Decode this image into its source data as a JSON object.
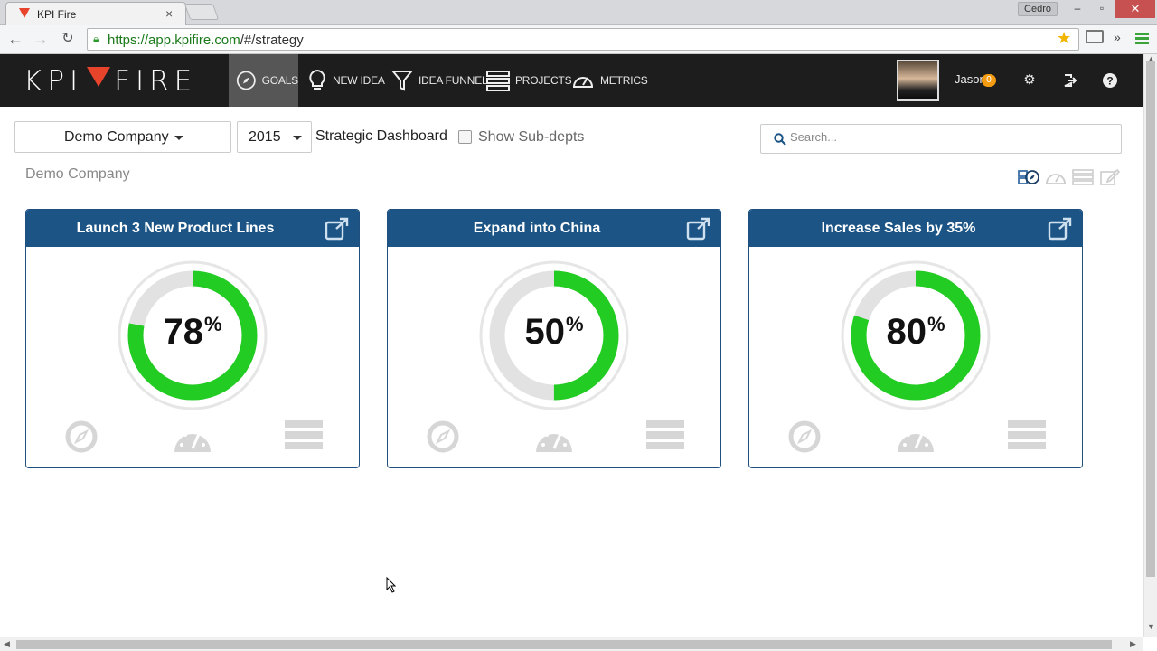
{
  "browser": {
    "tab_title": "KPI Fire",
    "tab_close": "×",
    "profile": "Cedro",
    "url_host": "https://app.kpifire.com",
    "url_path": "/#/strategy",
    "win_min": "–",
    "win_max": "▫",
    "win_close": "✕"
  },
  "app": {
    "logo": {
      "left": "KPI",
      "right": "FIRE"
    },
    "nav": [
      {
        "label": "GOALS",
        "icon": "compass-icon",
        "active": true
      },
      {
        "label": "NEW IDEA",
        "icon": "lightbulb-icon"
      },
      {
        "label": "IDEA FUNNEL",
        "icon": "funnel-icon"
      },
      {
        "label": "PROJECTS",
        "icon": "projects-icon"
      },
      {
        "label": "METRICS",
        "icon": "speedometer-icon"
      }
    ],
    "user": {
      "name": "Jason",
      "notifications": "0"
    }
  },
  "toolbar": {
    "company": "Demo Company",
    "year": "2015",
    "dashboard_title": "Strategic Dashboard",
    "show_subdepts": "Show Sub-depts",
    "search_placeholder": "Search..."
  },
  "company_heading": "Demo Company",
  "cards": [
    {
      "title": "Launch 3 New Product Lines",
      "percent": "78",
      "progress": 0.78,
      "pct_sign": "%"
    },
    {
      "title": "Expand into China",
      "percent": "50",
      "progress": 0.5,
      "pct_sign": "%"
    },
    {
      "title": "Increase Sales by 35%",
      "percent": "80",
      "progress": 0.8,
      "pct_sign": "%"
    }
  ],
  "colors": {
    "header_bg": "#1d1d1d",
    "card_header": "#1c5585",
    "gauge_fill": "#22cc22",
    "gauge_track": "#e2e2e2",
    "badge": "#f39c12"
  }
}
